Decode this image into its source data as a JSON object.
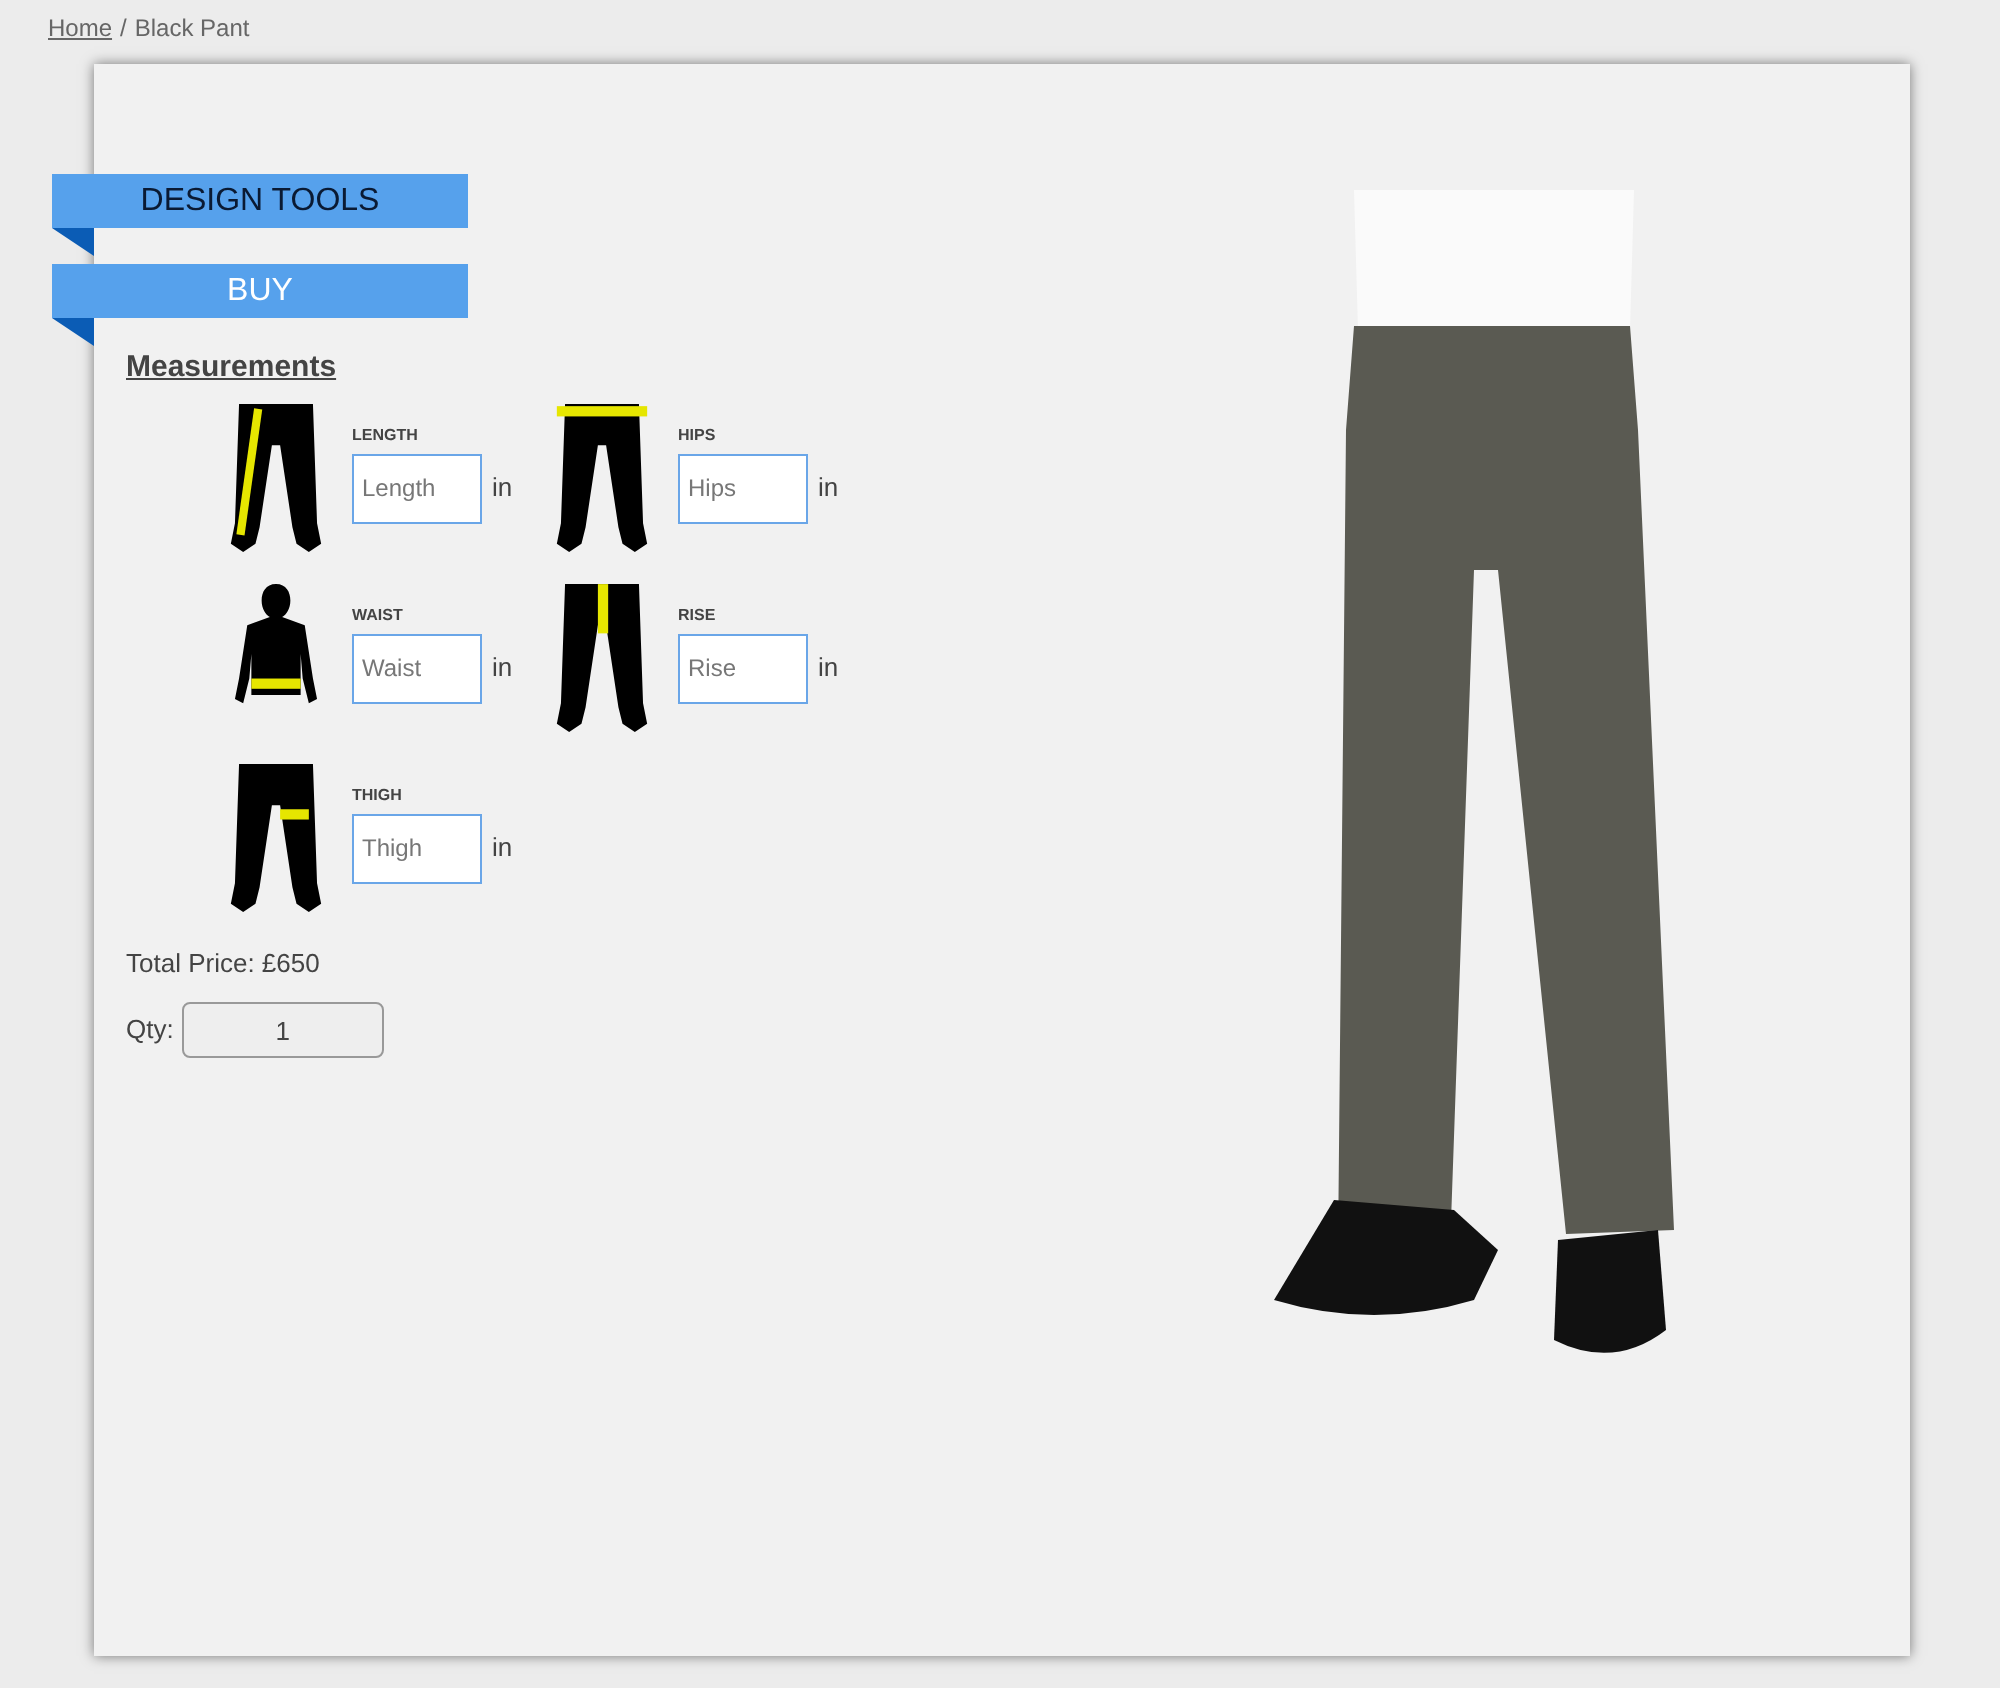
{
  "breadcrumb": {
    "home": "Home",
    "separator": "/",
    "current": "Black Pant"
  },
  "ribbons": [
    {
      "label": "DESIGN TOOLS",
      "selected": false
    },
    {
      "label": "BUY",
      "selected": true
    }
  ],
  "measurements": {
    "title": "Measurements",
    "fields": [
      {
        "kind": "length",
        "label": "LENGTH",
        "placeholder": "Length",
        "unit": "in"
      },
      {
        "kind": "hips",
        "label": "HIPS",
        "placeholder": "Hips",
        "unit": "in"
      },
      {
        "kind": "waist",
        "label": "WAIST",
        "placeholder": "Waist",
        "unit": "in"
      },
      {
        "kind": "rise",
        "label": "RISE",
        "placeholder": "Rise",
        "unit": "in"
      },
      {
        "kind": "thigh",
        "label": "THIGH",
        "placeholder": "Thigh",
        "unit": "in"
      }
    ]
  },
  "total_price": "Total Price: £650",
  "qty": {
    "label": "Qty:",
    "value": "1"
  }
}
